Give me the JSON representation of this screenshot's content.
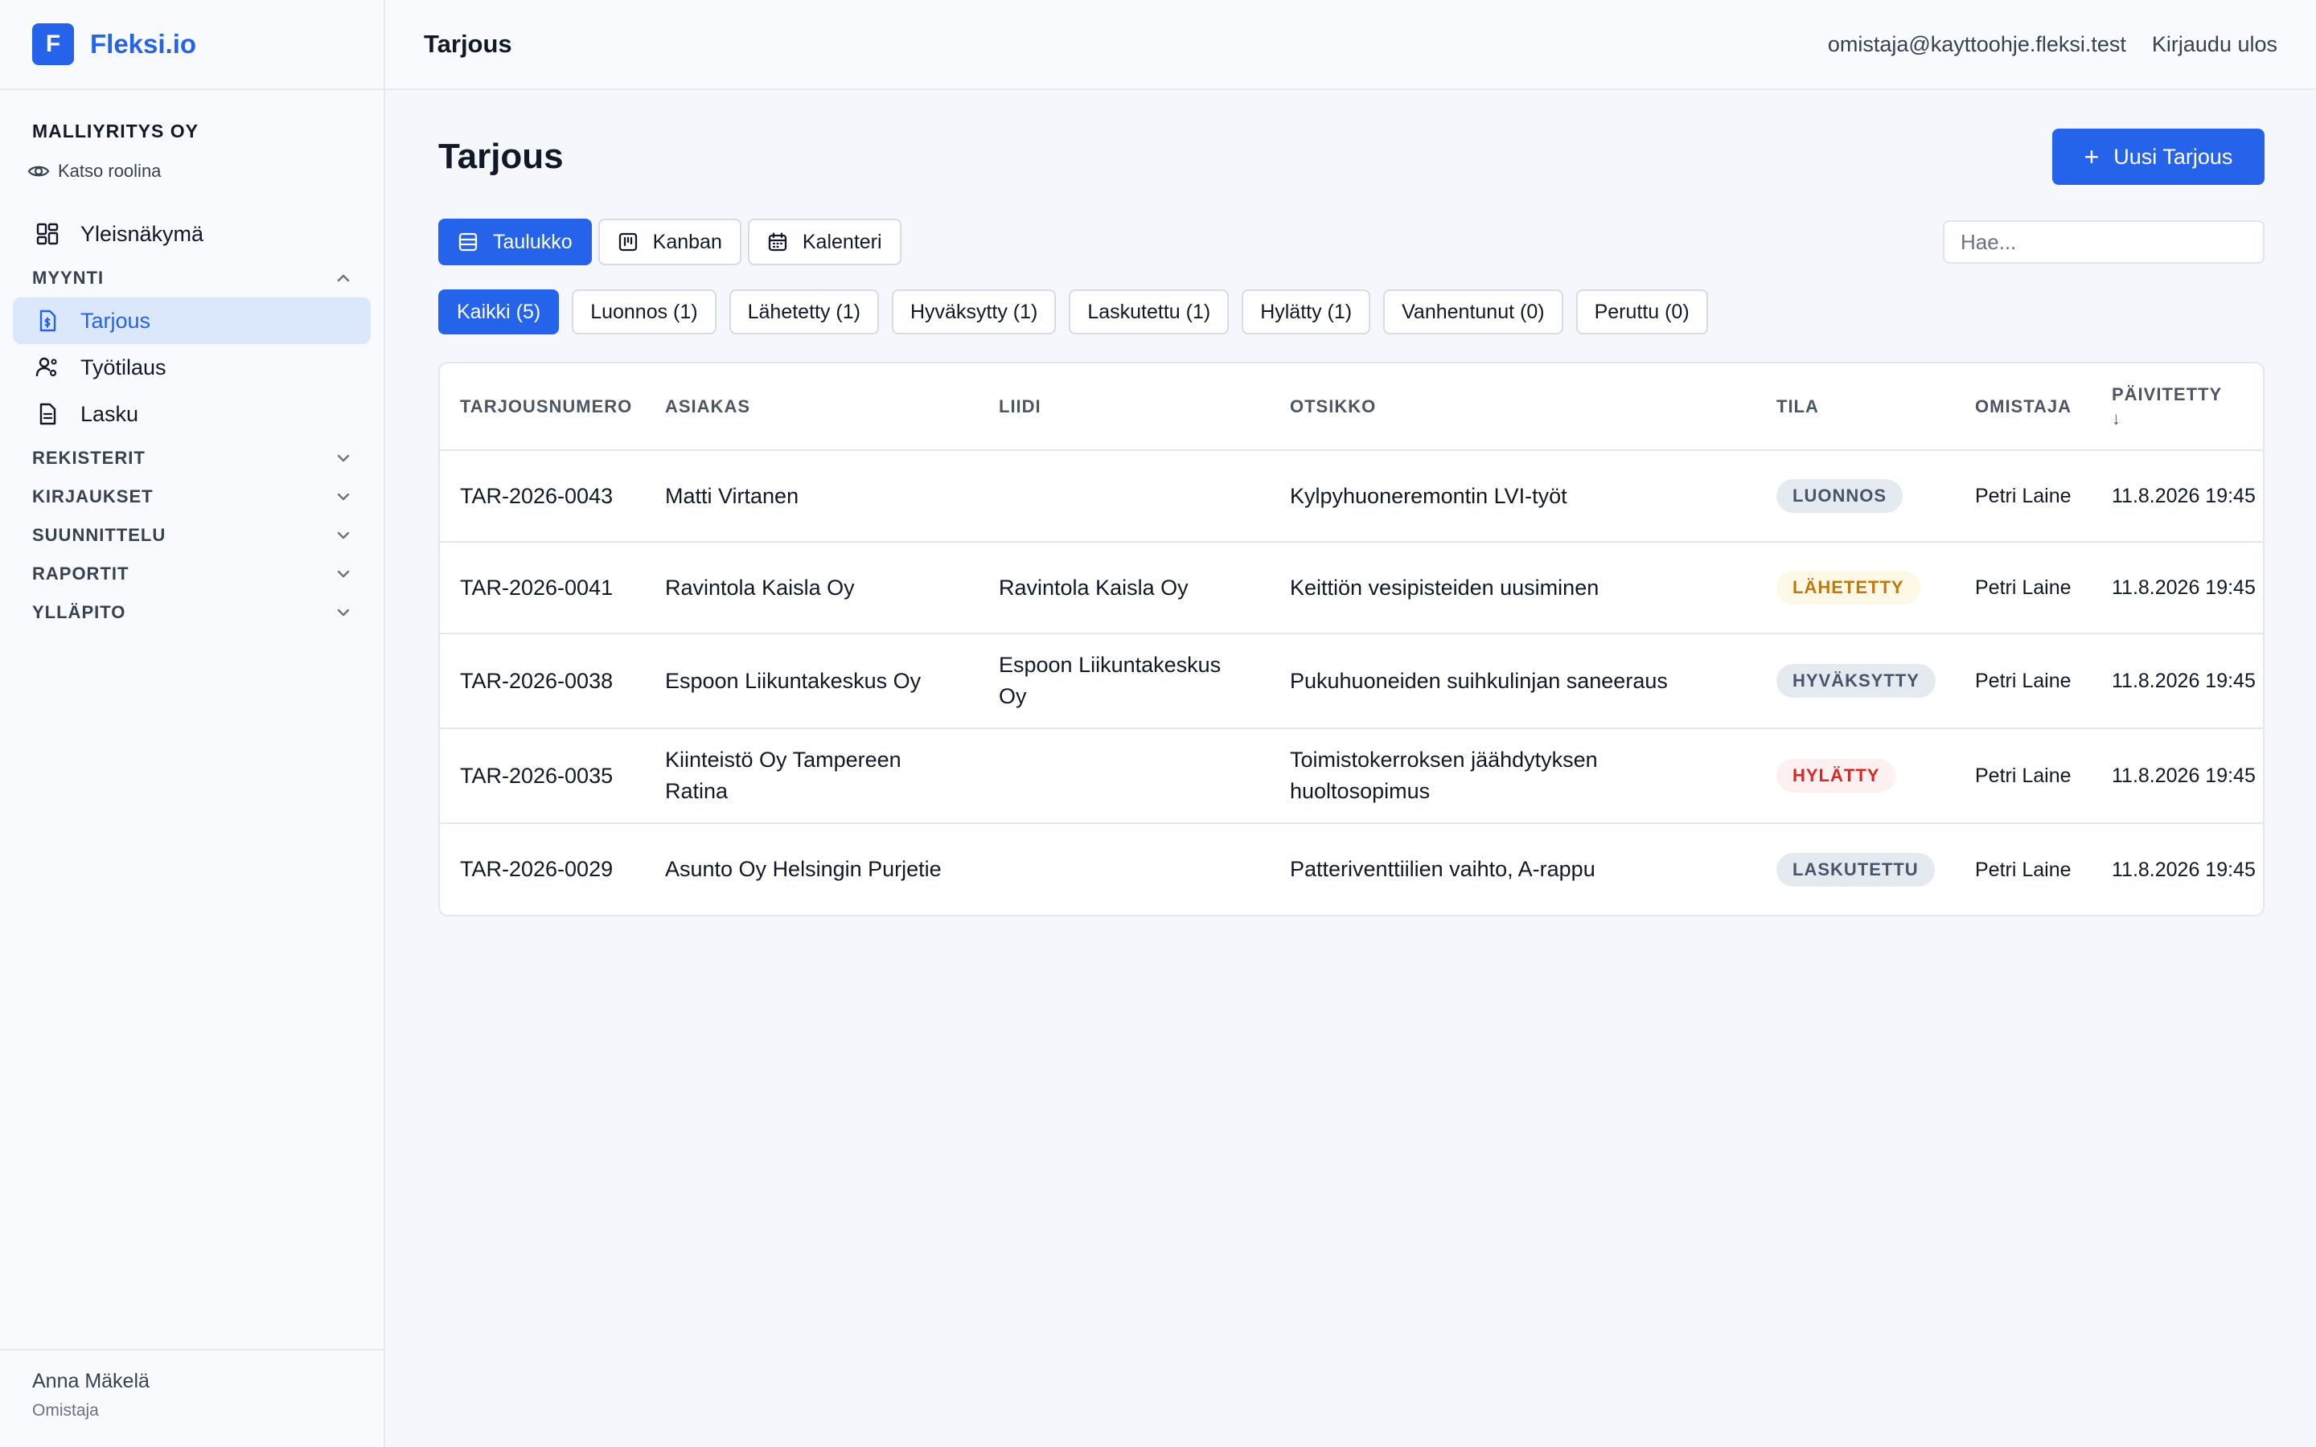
{
  "brand": {
    "logo_letter": "F",
    "name": "Fleksi.io",
    "color": "#2563eb"
  },
  "sidebar": {
    "company": "MALLIYRITYS OY",
    "role_view": "Katso roolina",
    "overview": "Yleisnäkymä",
    "sections": [
      {
        "label": "MYYNTI",
        "expanded": true,
        "items": [
          "Tarjous",
          "Työtilaus",
          "Lasku"
        ]
      },
      {
        "label": "REKISTERIT",
        "expanded": false
      },
      {
        "label": "KIRJAUKSET",
        "expanded": false
      },
      {
        "label": "SUUNNITTELU",
        "expanded": false
      },
      {
        "label": "RAPORTIT",
        "expanded": false
      },
      {
        "label": "YLLÄPITO",
        "expanded": false
      }
    ],
    "active_item": "Tarjous",
    "user": {
      "name": "Anna Mäkelä",
      "role": "Omistaja"
    }
  },
  "topbar": {
    "title": "Tarjous",
    "email": "omistaja@kayttoohje.fleksi.test",
    "logout": "Kirjaudu ulos"
  },
  "main": {
    "title": "Tarjous",
    "new_button": "Uusi Tarjous",
    "view_tabs": [
      "Taulukko",
      "Kanban",
      "Kalenteri"
    ],
    "active_view": "Taulukko",
    "search_placeholder": "Hae...",
    "filters": [
      "Kaikki (5)",
      "Luonnos (1)",
      "Lähetetty (1)",
      "Hyväksytty (1)",
      "Laskutettu (1)",
      "Hylätty (1)",
      "Vanhentunut (0)",
      "Peruttu (0)"
    ],
    "active_filter": "Kaikki (5)"
  },
  "table": {
    "columns": [
      "TARJOUSNUMERO",
      "ASIAKAS",
      "LIIDI",
      "OTSIKKO",
      "TILA",
      "OMISTAJA",
      "PÄIVITETTY"
    ],
    "sort_indicator": "↓",
    "rows": [
      {
        "number": "TAR-2026-0043",
        "customer": "Matti Virtanen",
        "lead": "",
        "title": "Kylpyhuoneremontin LVI-työt",
        "status": "LUONNOS",
        "owner": "Petri Laine",
        "updated": "11.8.2026 19:45"
      },
      {
        "number": "TAR-2026-0041",
        "customer": "Ravintola Kaisla Oy",
        "lead": "Ravintola Kaisla Oy",
        "title": "Keittiön vesipisteiden uusiminen",
        "status": "LÄHETETTY",
        "owner": "Petri Laine",
        "updated": "11.8.2026 19:45"
      },
      {
        "number": "TAR-2026-0038",
        "customer": "Espoon Liikuntakeskus Oy",
        "lead": "Espoon Liikuntakeskus Oy",
        "title": "Pukuhuoneiden suihkulinjan saneeraus",
        "status": "HYVÄKSYTTY",
        "owner": "Petri Laine",
        "updated": "11.8.2026 19:45"
      },
      {
        "number": "TAR-2026-0035",
        "customer": "Kiinteistö Oy Tampereen Ratina",
        "lead": "",
        "title": "Toimistokerroksen jäähdytyksen huoltosopimus",
        "status": "HYLÄTTY",
        "owner": "Petri Laine",
        "updated": "11.8.2026 19:45"
      },
      {
        "number": "TAR-2026-0029",
        "customer": "Asunto Oy Helsingin Purjetie",
        "lead": "",
        "title": "Patteriventtiilien vaihto, A-rappu",
        "status": "LASKUTETTU",
        "owner": "Petri Laine",
        "updated": "11.8.2026 19:45"
      }
    ]
  },
  "status_colors": {
    "LUONNOS": {
      "bg": "#e5e9f0",
      "fg": "#475569"
    },
    "LÄHETETTY": {
      "bg": "#fef9e7",
      "fg": "#c2780a"
    },
    "HYVÄKSYTTY": {
      "bg": "#e5e9f0",
      "fg": "#475569"
    },
    "HYLÄTTY": {
      "bg": "#fdf0f0",
      "fg": "#dc2626"
    },
    "LASKUTETTU": {
      "bg": "#e5e9f0",
      "fg": "#475569"
    }
  }
}
